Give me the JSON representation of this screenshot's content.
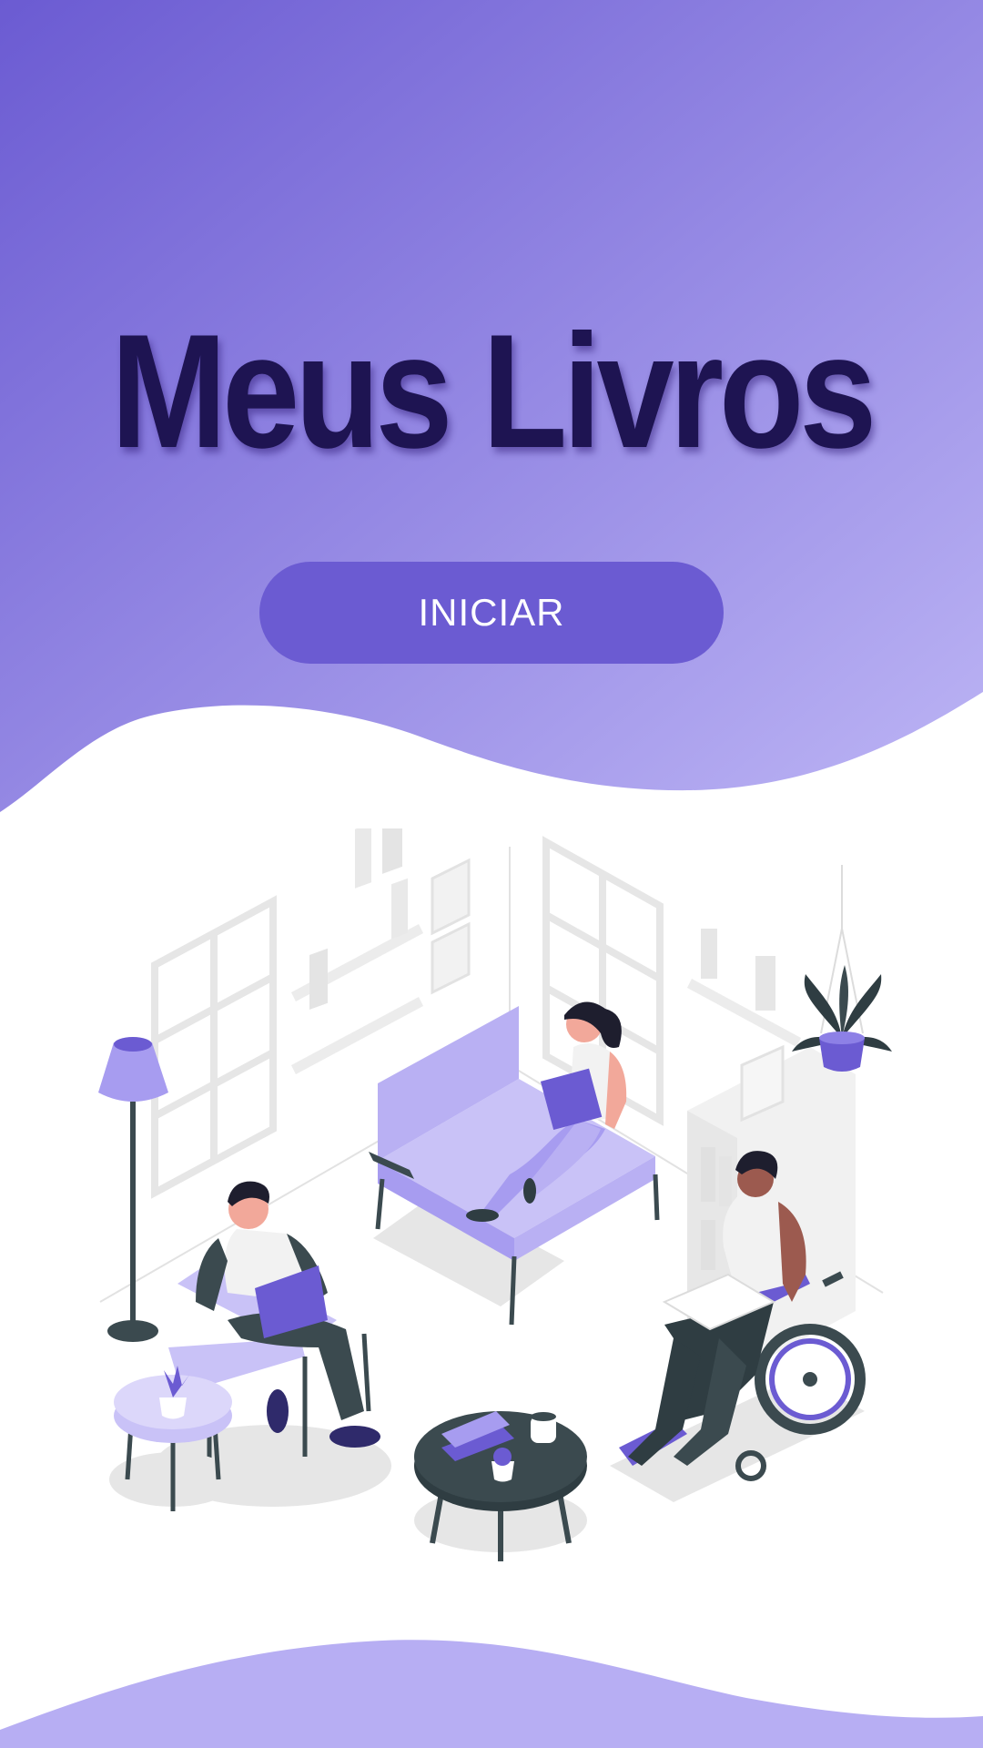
{
  "app": {
    "title": "Meus Livros",
    "start_button_label": "INICIAR"
  },
  "colors": {
    "gradient_start": "#6b5bd2",
    "gradient_end": "#b9b0f3",
    "button": "#6b5bd2",
    "title": "#1e1452",
    "accent_purple": "#6b5bd2",
    "light_purple": "#c9c2f7",
    "dark_slate": "#3b4a4f"
  },
  "illustration": {
    "icon": "reading-group-illustration"
  }
}
